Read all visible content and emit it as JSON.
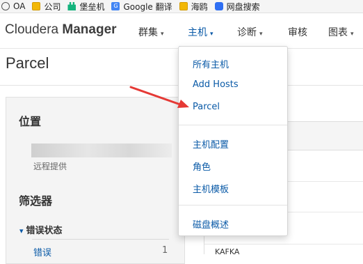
{
  "bookmarks": [
    {
      "label": "OA",
      "icon": "globe-icon"
    },
    {
      "label": "公司",
      "icon": "folder-icon"
    },
    {
      "label": "堡垒机",
      "icon": "bastion-icon"
    },
    {
      "label": "Google 翻译",
      "icon": "google-translate-icon"
    },
    {
      "label": "海鸥",
      "icon": "folder-icon"
    },
    {
      "label": "网盘搜索",
      "icon": "cloud-icon"
    }
  ],
  "navbar": {
    "brand_light": "Cloudera ",
    "brand_bold": "Manager",
    "items": [
      {
        "label": "群集",
        "caret": "▾"
      },
      {
        "label": "主机",
        "caret": "▾"
      },
      {
        "label": "诊断",
        "caret": "▾"
      },
      {
        "label": "审核",
        "caret": ""
      },
      {
        "label": "图表",
        "caret": "▾"
      }
    ]
  },
  "page": {
    "title": "Parcel"
  },
  "left_panel": {
    "location_heading": "位置",
    "remote_label": "远程提供",
    "filter_heading": "筛选器",
    "filter_group": "错误状态",
    "filter_group_chevron": "▾",
    "filter_item": {
      "label": "错误",
      "count": "1"
    }
  },
  "table": {
    "partial_row": "KAFKA"
  },
  "dropdown": {
    "items": [
      "所有主机",
      "Add Hosts",
      "Parcel",
      "主机配置",
      "角色",
      "主机模板",
      "磁盘概述"
    ]
  },
  "colors": {
    "accent": "#0a5aa7",
    "arrow": "#e53935"
  }
}
